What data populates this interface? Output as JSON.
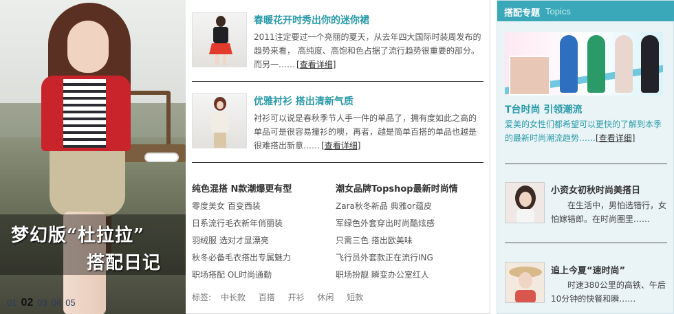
{
  "hero": {
    "caption_line1": "梦幻版“杜拉拉”",
    "caption_line2": "搭配日记",
    "pager": [
      "01",
      "02",
      "03",
      "04",
      "05"
    ],
    "pager_active": "02"
  },
  "articles": [
    {
      "title": "春暖花开时秀出你的迷你裙",
      "desc": "2011注定要过一个亮丽的夏天，从去年四大国际时装周发布的趋势来看， 高纯度、高饱和色占据了流行趋势很重要的部分。而另一……",
      "more": "[查看详细]"
    },
    {
      "title": "优雅衬衫 搭出清新气质",
      "desc": "衬衫可以说是春秋季节人手一件的单品了，拥有度如此之高的单品可是很容易撞衫的噢，再者，越是简单百搭的单品也越是很难搭出新意……",
      "more": "[查看详细]"
    }
  ],
  "lists": [
    {
      "heading": "纯色混搭 N款潮爆更有型",
      "items": [
        "零度美女 百变西装",
        "日系流行毛衣新年俏丽装",
        "羽绒服 选对才显漂亮",
        "秋冬必备毛衣搭出专属魅力",
        "职场搭配 OL时尚通勤"
      ]
    },
    {
      "heading": "潮女品牌Topshop最新时尚情",
      "items": [
        "Zara秋冬新品 典雅or蕴皮",
        "军绿色外套穿出时尚酷炫感",
        "只需三色 搭出欧美味",
        "飞行员外套款正在流行ING",
        "职场扮靓 瞬变办公室红人"
      ]
    }
  ],
  "tags": {
    "label": "标签:",
    "items": [
      "中长款",
      "百搭",
      "开衫",
      "休闲",
      "短款"
    ]
  },
  "sidebar": {
    "heading_zh": "搭配专题",
    "heading_en": "Topics",
    "feature": {
      "title": "T台时尚 引领潮流",
      "desc": "爱美的女性们都希望可以更快的了解到本季的最新时尚潮流趋势……",
      "more": "[查看详细]"
    },
    "items": [
      {
        "title": "小资女初秋时尚美搭日",
        "desc": "在生活中，男怕选错行，女怕嫁错郎。在时尚圈里……",
        "more": ""
      },
      {
        "title": "追上今夏“速时尚”",
        "desc": "时速380公里的高铁、午后10分钟的快餐和瞬……",
        "more": ""
      }
    ]
  },
  "colors": {
    "accent_teal": "#2a9aa8",
    "sidebar_header": "#3aa8b8",
    "sidebar_bg": "#eaf4f7"
  }
}
